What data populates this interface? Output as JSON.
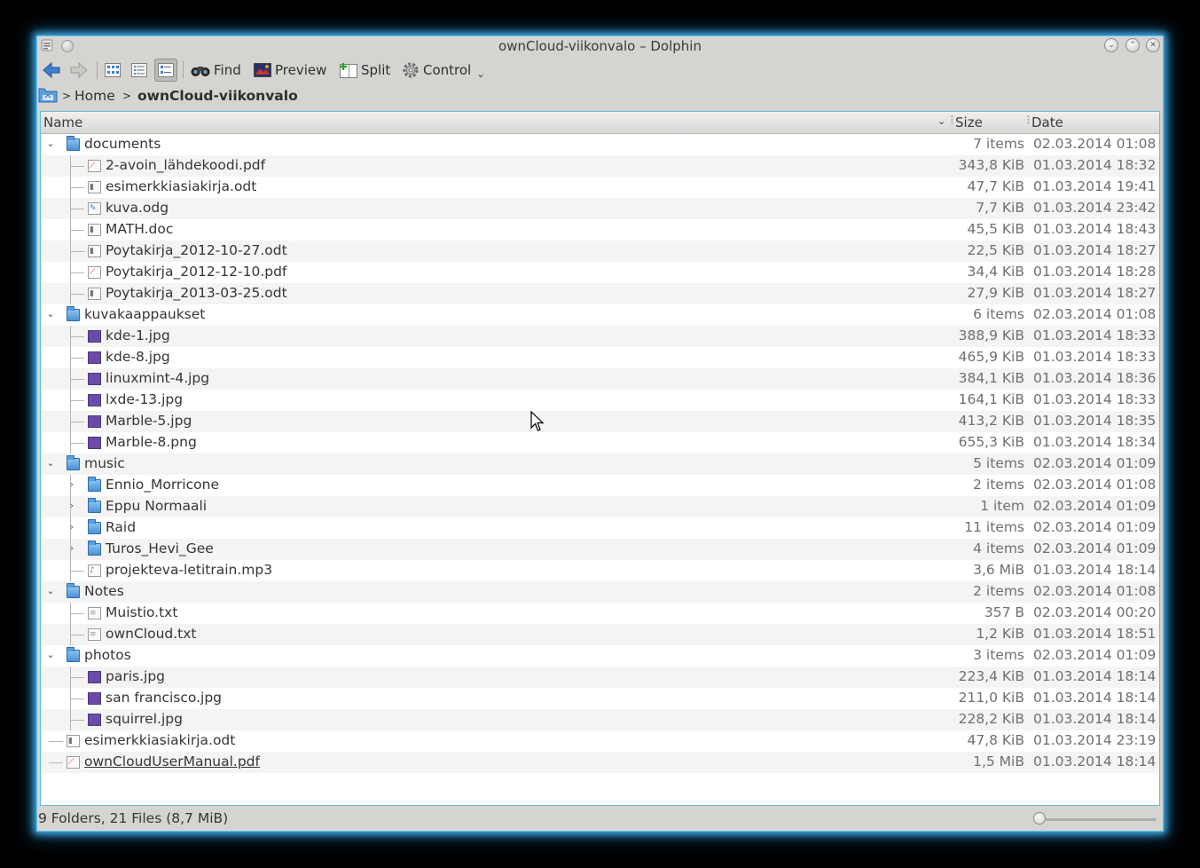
{
  "window": {
    "title": "ownCloud-viikonvalo – Dolphin"
  },
  "toolbar": {
    "find": "Find",
    "preview": "Preview",
    "split": "Split",
    "control": "Control"
  },
  "breadcrumb": {
    "home": "Home",
    "current": "ownCloud-viikonvalo"
  },
  "columns": {
    "name": "Name",
    "size": "Size",
    "date": "Date"
  },
  "rows": [
    {
      "name": "documents",
      "size": "7 items",
      "date": "02.03.2014 01:08",
      "type": "folder",
      "level": 0,
      "expanded": true
    },
    {
      "name": "2-avoin_lähdekoodi.pdf",
      "size": "343,8 KiB",
      "date": "01.03.2014 18:32",
      "type": "pdf",
      "level": 1
    },
    {
      "name": "esimerkkiasiakirja.odt",
      "size": "47,7 KiB",
      "date": "01.03.2014 19:41",
      "type": "odt",
      "level": 1
    },
    {
      "name": "kuva.odg",
      "size": "7,7 KiB",
      "date": "01.03.2014 23:42",
      "type": "odg",
      "level": 1
    },
    {
      "name": "MATH.doc",
      "size": "45,5 KiB",
      "date": "01.03.2014 18:43",
      "type": "doc",
      "level": 1
    },
    {
      "name": "Poytakirja_2012-10-27.odt",
      "size": "22,5 KiB",
      "date": "01.03.2014 18:27",
      "type": "odt",
      "level": 1
    },
    {
      "name": "Poytakirja_2012-12-10.pdf",
      "size": "34,4 KiB",
      "date": "01.03.2014 18:28",
      "type": "pdf",
      "level": 1
    },
    {
      "name": "Poytakirja_2013-03-25.odt",
      "size": "27,9 KiB",
      "date": "01.03.2014 18:27",
      "type": "odt",
      "level": 1
    },
    {
      "name": "kuvakaappaukset",
      "size": "6 items",
      "date": "02.03.2014 01:08",
      "type": "folder",
      "level": 0,
      "expanded": true
    },
    {
      "name": "kde-1.jpg",
      "size": "388,9 KiB",
      "date": "01.03.2014 18:33",
      "type": "image",
      "level": 1
    },
    {
      "name": "kde-8.jpg",
      "size": "465,9 KiB",
      "date": "01.03.2014 18:33",
      "type": "image",
      "level": 1
    },
    {
      "name": "linuxmint-4.jpg",
      "size": "384,1 KiB",
      "date": "01.03.2014 18:36",
      "type": "image",
      "level": 1
    },
    {
      "name": "lxde-13.jpg",
      "size": "164,1 KiB",
      "date": "01.03.2014 18:33",
      "type": "image",
      "level": 1
    },
    {
      "name": "Marble-5.jpg",
      "size": "413,2 KiB",
      "date": "01.03.2014 18:35",
      "type": "image",
      "level": 1
    },
    {
      "name": "Marble-8.png",
      "size": "655,3 KiB",
      "date": "01.03.2014 18:34",
      "type": "image",
      "level": 1
    },
    {
      "name": "music",
      "size": "5 items",
      "date": "02.03.2014 01:09",
      "type": "folder",
      "level": 0,
      "expanded": true
    },
    {
      "name": "Ennio_Morricone",
      "size": "2 items",
      "date": "02.03.2014 01:08",
      "type": "folder",
      "level": 1,
      "expanded": false
    },
    {
      "name": "Eppu Normaali",
      "size": "1 item",
      "date": "02.03.2014 01:09",
      "type": "folder",
      "level": 1,
      "expanded": false
    },
    {
      "name": "Raid",
      "size": "11 items",
      "date": "02.03.2014 01:09",
      "type": "folder",
      "level": 1,
      "expanded": false
    },
    {
      "name": "Turos_Hevi_Gee",
      "size": "4 items",
      "date": "02.03.2014 01:09",
      "type": "folder",
      "level": 1,
      "expanded": false
    },
    {
      "name": "projekteva-letitrain.mp3",
      "size": "3,6 MiB",
      "date": "01.03.2014 18:14",
      "type": "audio",
      "level": 1
    },
    {
      "name": "Notes",
      "size": "2 items",
      "date": "02.03.2014 01:08",
      "type": "folder",
      "level": 0,
      "expanded": true
    },
    {
      "name": "Muistio.txt",
      "size": "357 B",
      "date": "02.03.2014 00:20",
      "type": "text",
      "level": 1
    },
    {
      "name": "ownCloud.txt",
      "size": "1,2 KiB",
      "date": "01.03.2014 18:51",
      "type": "text",
      "level": 1
    },
    {
      "name": "photos",
      "size": "3 items",
      "date": "02.03.2014 01:09",
      "type": "folder",
      "level": 0,
      "expanded": true
    },
    {
      "name": "paris.jpg",
      "size": "223,4 KiB",
      "date": "01.03.2014 18:14",
      "type": "image",
      "level": 1
    },
    {
      "name": "san francisco.jpg",
      "size": "211,0 KiB",
      "date": "01.03.2014 18:14",
      "type": "image",
      "level": 1
    },
    {
      "name": "squirrel.jpg",
      "size": "228,2 KiB",
      "date": "01.03.2014 18:14",
      "type": "image",
      "level": 1
    },
    {
      "name": "esimerkkiasiakirja.odt",
      "size": "47,8 KiB",
      "date": "01.03.2014 23:19",
      "type": "odt",
      "level": 0
    },
    {
      "name": "ownCloudUserManual.pdf",
      "size": "1,5 MiB",
      "date": "01.03.2014 18:14",
      "type": "pdf",
      "level": 0,
      "hovered": true
    }
  ],
  "status": {
    "text": "9 Folders, 21 Files (8,7 MiB)",
    "zoom_level": 0
  },
  "colors": {
    "window_glow": "#3fb0e8",
    "folder": "#4b90d6",
    "pdf": "#d9382f",
    "image": "#6b4aa8",
    "audio": "#3aa13a"
  }
}
